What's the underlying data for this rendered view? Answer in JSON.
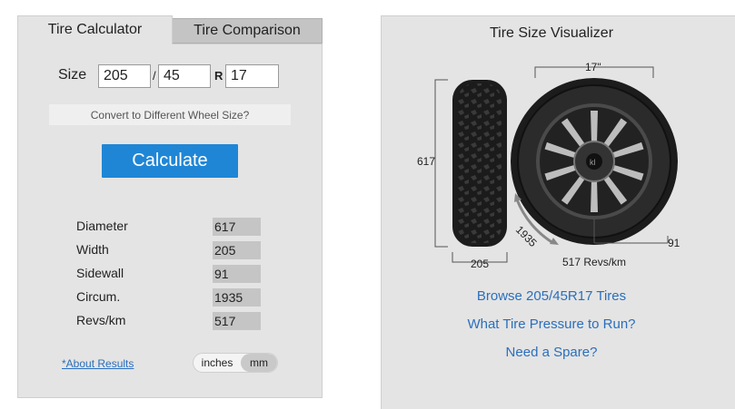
{
  "tabs": {
    "calculator": "Tire Calculator",
    "comparison": "Tire Comparison"
  },
  "size": {
    "label": "Size",
    "width": "205",
    "slash": "/",
    "aspect": "45",
    "r_label": "R",
    "rim": "17"
  },
  "convert_label": "Convert to Different Wheel Size?",
  "calculate_label": "Calculate",
  "results": [
    {
      "label": "Diameter",
      "value": "617"
    },
    {
      "label": "Width",
      "value": "205"
    },
    {
      "label": "Sidewall",
      "value": "91"
    },
    {
      "label": "Circum.",
      "value": "1935"
    },
    {
      "label": "Revs/km",
      "value": "517"
    }
  ],
  "about_link": "*About Results",
  "units": {
    "inches": "inches",
    "mm": "mm",
    "selected": "mm"
  },
  "visualizer": {
    "title": "Tire Size Visualizer",
    "rim_label": "17\"",
    "diameter_label": "617",
    "width_label": "205",
    "sidewall_label": "91",
    "circumference_label": "1935",
    "revs_label": "517 Revs/km"
  },
  "links": {
    "browse": "Browse 205/45R17 Tires",
    "pressure": "What Tire Pressure to Run?",
    "spare": "Need a Spare?"
  },
  "colors": {
    "accent": "#1f86d6",
    "link": "#2a6fbd",
    "panel": "#e4e4e4"
  }
}
